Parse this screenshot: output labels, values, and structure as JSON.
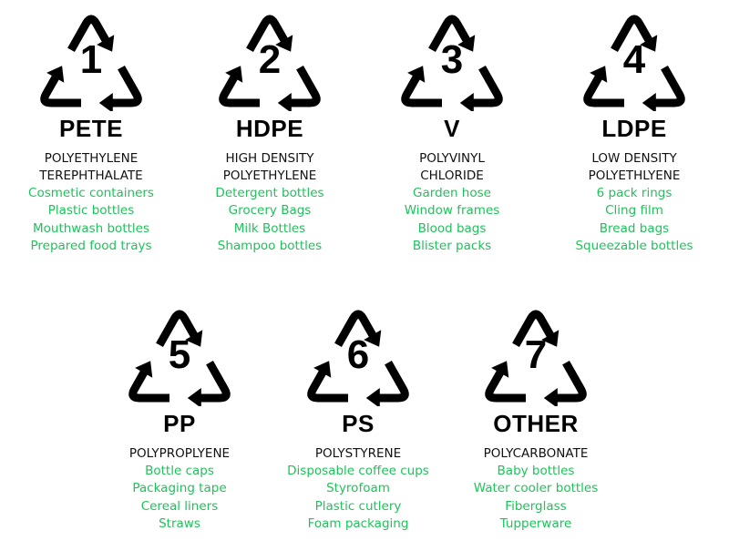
{
  "symbols": [
    {
      "number": "1",
      "code": "PETE",
      "name_lines": [
        "POLYETHYLENE",
        "TEREPHTHALATE"
      ],
      "uses": [
        "Cosmetic containers",
        "Plastic bottles",
        "Mouthwash bottles",
        "Prepared food trays"
      ]
    },
    {
      "number": "2",
      "code": "HDPE",
      "name_lines": [
        "HIGH DENSITY",
        "POLYETHYLENE"
      ],
      "uses": [
        "Detergent bottles",
        "Grocery Bags",
        "Milk Bottles",
        "Shampoo bottles"
      ]
    },
    {
      "number": "3",
      "code": "V",
      "name_lines": [
        "POLYVINYL",
        "CHLORIDE"
      ],
      "uses": [
        "Garden hose",
        "Window frames",
        "Blood bags",
        "Blister packs"
      ]
    },
    {
      "number": "4",
      "code": "LDPE",
      "name_lines": [
        "LOW DENSITY",
        "POLYETHLYENE"
      ],
      "uses": [
        "6 pack rings",
        "Cling film",
        "Bread bags",
        "Squeezable bottles"
      ]
    },
    {
      "number": "5",
      "code": "PP",
      "name_lines": [
        "POLYPROPLYENE"
      ],
      "uses": [
        "Bottle caps",
        "Packaging tape",
        "Cereal liners",
        "Straws"
      ]
    },
    {
      "number": "6",
      "code": "PS",
      "name_lines": [
        "POLYSTYRENE"
      ],
      "uses": [
        "Disposable coffee cups",
        "Styrofoam",
        "Plastic cutlery",
        "Foam packaging"
      ]
    },
    {
      "number": "7",
      "code": "OTHER",
      "name_lines": [
        "POLYCARBONATE"
      ],
      "uses": [
        "Baby bottles",
        "Water cooler bottles",
        "Fiberglass",
        "Tupperware"
      ]
    }
  ],
  "colors": {
    "text": "#000000",
    "uses": "#1fc25a"
  },
  "icon": "recycling-triangle-icon"
}
